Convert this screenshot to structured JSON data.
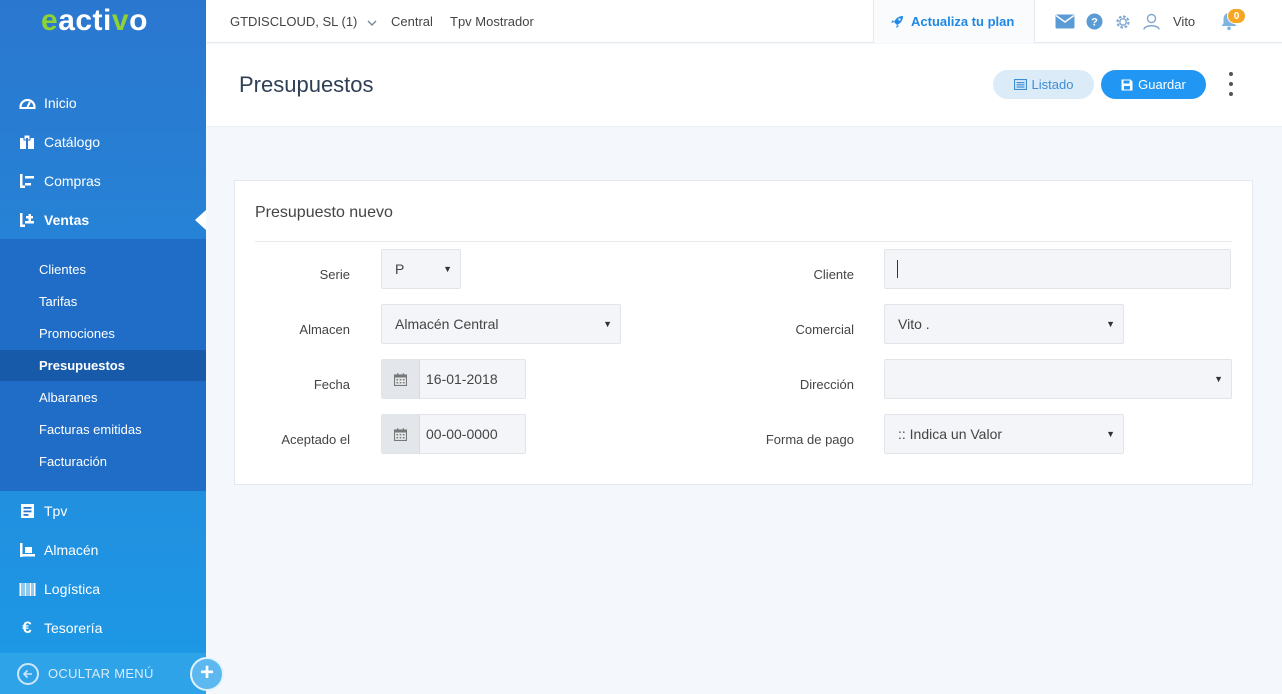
{
  "brand": {
    "logo_e": "e",
    "logo_mid": "acti",
    "logo_v": "v",
    "logo_o": "o"
  },
  "sidebar": {
    "items": [
      {
        "label": "Inicio",
        "icon": "dashboard-icon"
      },
      {
        "label": "Catálogo",
        "icon": "catalog-icon"
      },
      {
        "label": "Compras",
        "icon": "purchases-icon"
      },
      {
        "label": "Ventas",
        "icon": "sales-icon",
        "active": true
      },
      {
        "label": "Tpv",
        "icon": "receipt-icon"
      },
      {
        "label": "Almacén",
        "icon": "warehouse-icon"
      },
      {
        "label": "Logística",
        "icon": "barcode-icon"
      },
      {
        "label": "Tesorería",
        "icon": "euro-icon"
      }
    ],
    "submenu": [
      {
        "label": "Clientes"
      },
      {
        "label": "Tarifas"
      },
      {
        "label": "Promociones"
      },
      {
        "label": "Presupuestos",
        "active": true
      },
      {
        "label": "Albaranes"
      },
      {
        "label": "Facturas emitidas"
      },
      {
        "label": "Facturación"
      }
    ],
    "hide_menu_label": "OCULTAR MENÚ",
    "plus_label": "+"
  },
  "topbar": {
    "company": "GTDISCLOUD, SL (1)",
    "links": [
      "Central",
      "Tpv Mostrador"
    ],
    "upgrade_label": "Actualiza tu plan",
    "user_name": "Vito",
    "notifications_count": "0"
  },
  "page": {
    "title": "Presupuestos",
    "listado_label": "Listado",
    "guardar_label": "Guardar"
  },
  "form": {
    "title": "Presupuesto nuevo",
    "serie": {
      "label": "Serie",
      "value": "P"
    },
    "almacen": {
      "label": "Almacen",
      "value": "Almacén Central"
    },
    "fecha": {
      "label": "Fecha",
      "value": "16-01-2018"
    },
    "aceptado": {
      "label": "Aceptado el",
      "value": "00-00-0000"
    },
    "cliente": {
      "label": "Cliente",
      "value": ""
    },
    "comercial": {
      "label": "Comercial",
      "value": "Vito ."
    },
    "direccion": {
      "label": "Dirección",
      "value": ""
    },
    "forma_pago": {
      "label": "Forma de pago",
      "value": ":: Indica un Valor"
    }
  },
  "colors": {
    "primary": "#2196f3",
    "brand_green": "#8ed233",
    "sidebar_dark": "#1f6dc7",
    "badge": "#f5a623"
  }
}
